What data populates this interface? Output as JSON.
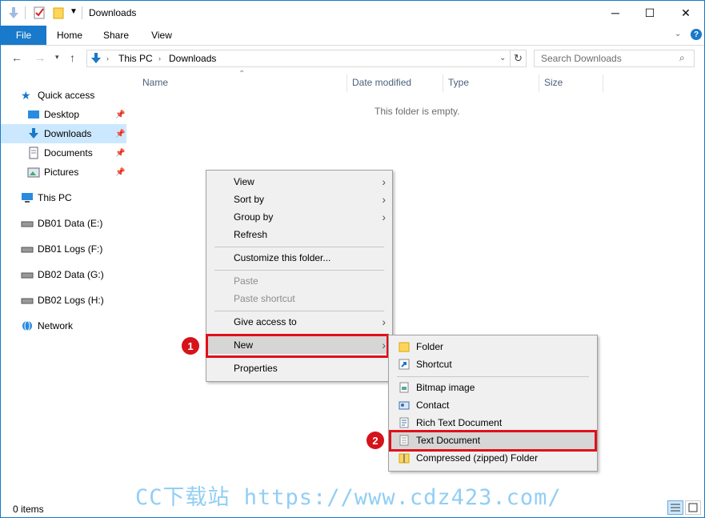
{
  "window": {
    "title": "Downloads"
  },
  "ribbon": {
    "tabs": [
      "File",
      "Home",
      "Share",
      "View"
    ]
  },
  "address": {
    "crumbs": [
      "This PC",
      "Downloads"
    ]
  },
  "search": {
    "placeholder": "Search Downloads"
  },
  "sidebar": {
    "quick_access": "Quick access",
    "pinned": [
      "Desktop",
      "Downloads",
      "Documents",
      "Pictures"
    ],
    "this_pc": "This PC",
    "drives": [
      "DB01 Data (E:)",
      "DB01 Logs (F:)",
      "DB02 Data (G:)",
      "DB02 Logs (H:)"
    ],
    "network": "Network"
  },
  "columns": [
    "Name",
    "Date modified",
    "Type",
    "Size"
  ],
  "content": {
    "empty_text": "This folder is empty."
  },
  "status": {
    "count": "0 items"
  },
  "context_menu": {
    "items": [
      "View",
      "Sort by",
      "Group by",
      "Refresh",
      "Customize this folder...",
      "Paste",
      "Paste shortcut",
      "Give access to",
      "New",
      "Properties"
    ]
  },
  "new_submenu": {
    "items": [
      "Folder",
      "Shortcut",
      "Bitmap image",
      "Contact",
      "Rich Text Document",
      "Text Document",
      "Compressed (zipped) Folder"
    ]
  },
  "badges": [
    "1",
    "2"
  ],
  "watermark": "CC下载站 https://www.cdz423.com/",
  "colors": {
    "accent": "#1979ca",
    "highlight": "#e0101a",
    "selected": "#cce8ff"
  }
}
